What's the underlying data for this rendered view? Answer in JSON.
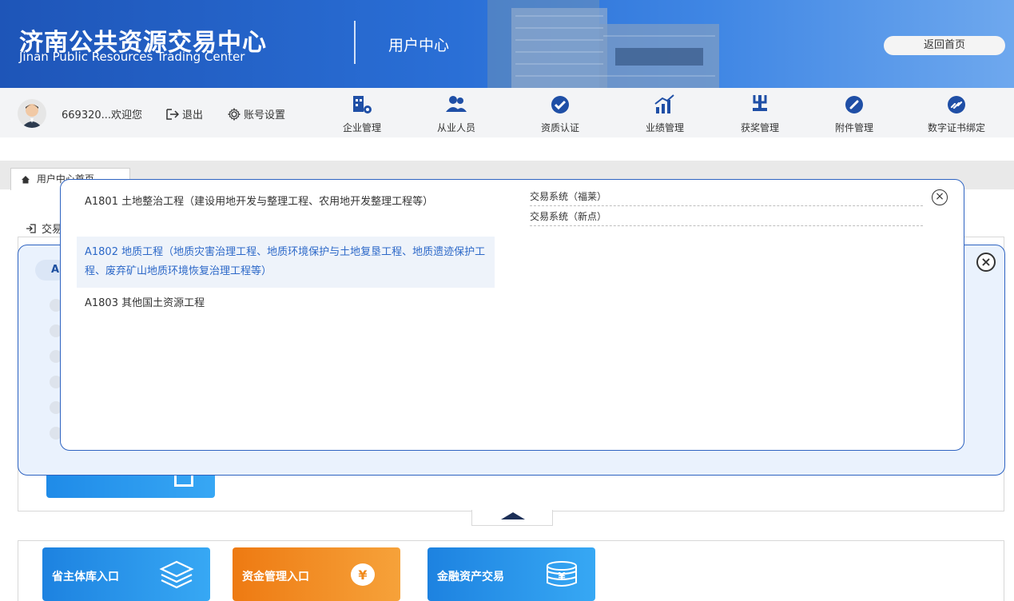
{
  "header": {
    "brand_cn": "济南公共资源交易中心",
    "brand_en": "Jinan Public Resources Trading Center",
    "subtitle": "用户中心",
    "back_home_label": "返回首页"
  },
  "toolbar": {
    "user_text": "669320...欢迎您",
    "logout_label": "退出",
    "account_settings_label": "账号设置",
    "nav": [
      {
        "label": "企业管理",
        "icon": "company-manage-icon"
      },
      {
        "label": "从业人员",
        "icon": "staff-icon"
      },
      {
        "label": "资质认证",
        "icon": "qualification-icon"
      },
      {
        "label": "业绩管理",
        "icon": "performance-icon"
      },
      {
        "label": "获奖管理",
        "icon": "award-icon"
      },
      {
        "label": "附件管理",
        "icon": "attachment-icon"
      },
      {
        "label": "数字证书绑定",
        "icon": "certificate-link-icon"
      }
    ]
  },
  "breadcrumb": {
    "tab_label": "用户中心首页"
  },
  "background": {
    "section_title": "交易",
    "pill_label": "A"
  },
  "dialog": {
    "options": [
      {
        "code": "A1801",
        "text": "A1801 土地整治工程（建设用地开发与整理工程、农用地开发整理工程等）",
        "selected": false
      },
      {
        "code": "A1802",
        "text": "A1802 地质工程（地质灾害治理工程、地质环境保护与土地复垦工程、地质遗迹保护工程、废弃矿山地质环境恢复治理工程等）",
        "selected": true
      },
      {
        "code": "A1803",
        "text": "A1803 其他国土资源工程",
        "selected": false
      }
    ],
    "systems": [
      "交易系统（福莱）",
      "交易系统（新点）"
    ]
  },
  "entries": [
    {
      "label": "省主体库入口",
      "icon": "layers-icon",
      "color": "#2a8fe6"
    },
    {
      "label": "资金管理入口",
      "icon": "yuan-coin-icon",
      "color": "#f08a1c"
    },
    {
      "label": "金融资产交易",
      "icon": "coins-stack-icon",
      "color": "#2a8fe6"
    }
  ],
  "colors": {
    "header_blue": "#1e55b8",
    "modal_border": "#2e63c1",
    "selected_text": "#2c68c8",
    "orange": "#f08a1c"
  }
}
